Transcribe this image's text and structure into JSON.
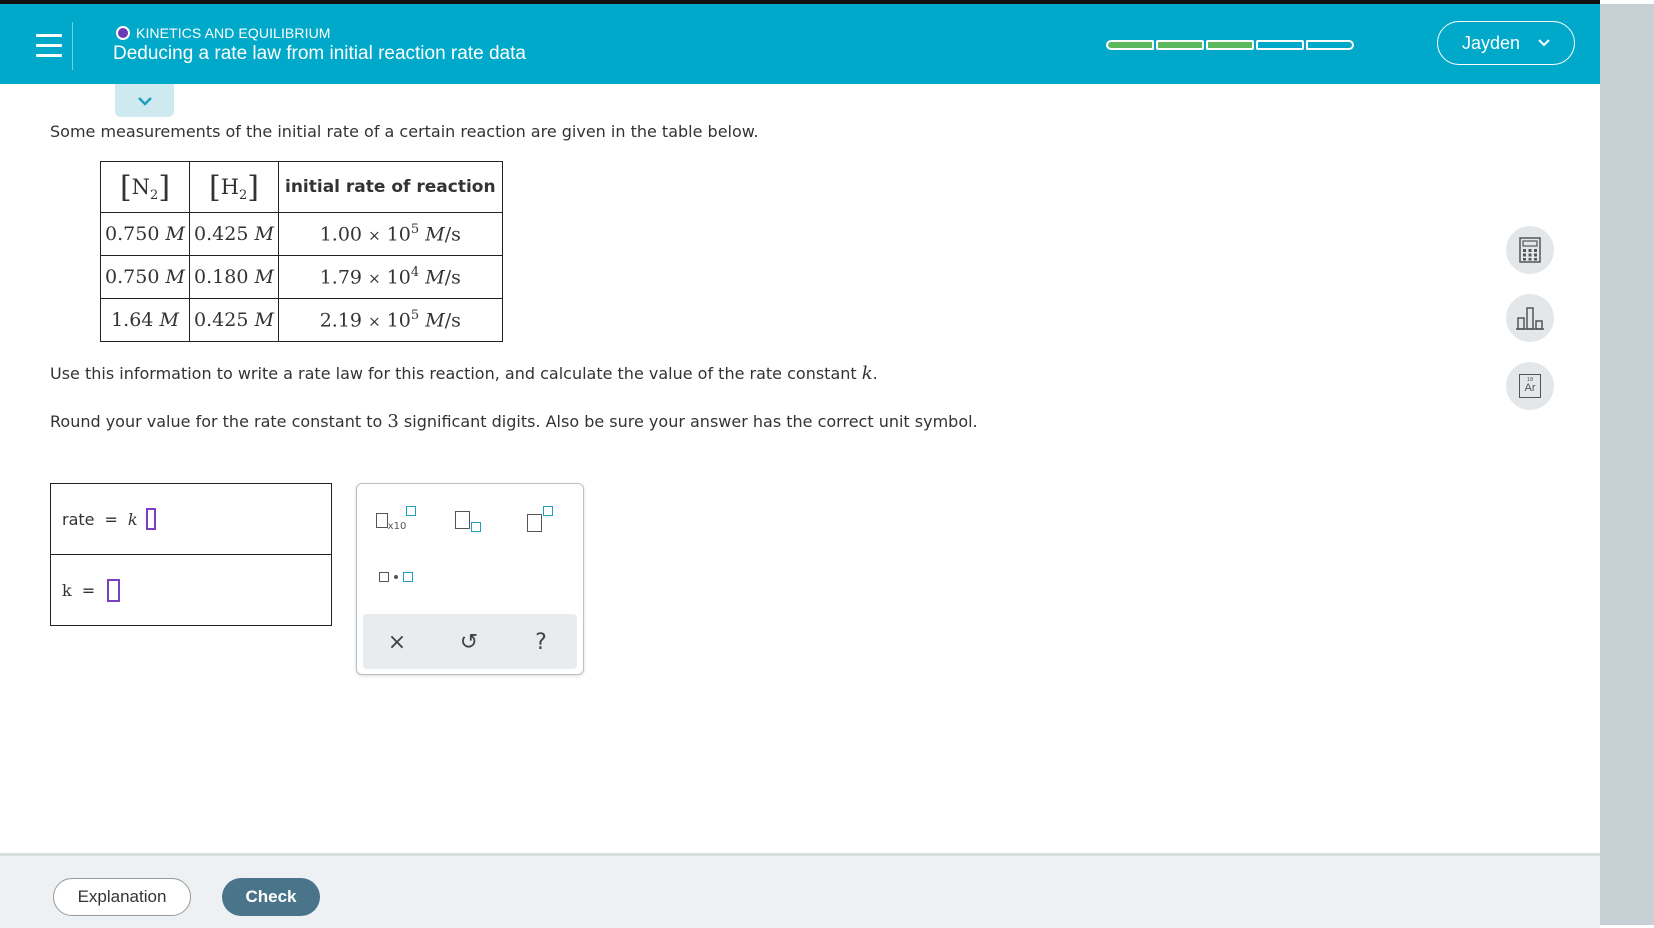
{
  "header": {
    "topic": "KINETICS AND EQUILIBRIUM",
    "title": "Deducing a rate law from initial reaction rate data",
    "progress": {
      "filled": 3,
      "total": 5
    },
    "user_name": "Jayden"
  },
  "problem": {
    "intro": "Some measurements of the initial rate of a certain reaction are given in the table below.",
    "instruction_a": "Use this information to write a rate law for this reaction, and calculate the value of the rate constant",
    "instruction_var": "k",
    "instruction_end": ".",
    "round_a": "Round your value for the rate constant to",
    "round_num": "3",
    "round_b": "significant digits. Also be sure your answer has the correct unit symbol."
  },
  "table": {
    "col1_species": "N",
    "col1_sub": "2",
    "col2_species": "H",
    "col2_sub": "2",
    "col3_header": "initial rate of reaction",
    "rows": [
      {
        "n2": "0.750",
        "h2": "0.425",
        "coef": "1.00",
        "exp": "5"
      },
      {
        "n2": "0.750",
        "h2": "0.180",
        "coef": "1.79",
        "exp": "4"
      },
      {
        "n2": "1.64",
        "h2": "0.425",
        "coef": "2.19",
        "exp": "5"
      }
    ],
    "conc_unit": "M",
    "rate_times": "×",
    "rate_base": "10",
    "rate_unit_M": "M",
    "rate_unit_s": "/s"
  },
  "answer": {
    "rate_label": "rate",
    "equals": "=",
    "k_label": "k",
    "k_row_label": "k"
  },
  "keypad": {
    "x10_label": "x10",
    "footer": {
      "clear": "×",
      "undo": "↺",
      "help": "?"
    }
  },
  "footer": {
    "explanation_label": "Explanation",
    "check_label": "Check"
  },
  "side_tools": {
    "periodic_number": "18",
    "periodic_symbol": "Ar"
  },
  "colors": {
    "header_bg": "#00a9c9",
    "progress_fill": "#5cb85c",
    "check_button": "#49748a",
    "input_cursor": "#7b3fc4",
    "keypad_accent": "#1f9ec0"
  }
}
